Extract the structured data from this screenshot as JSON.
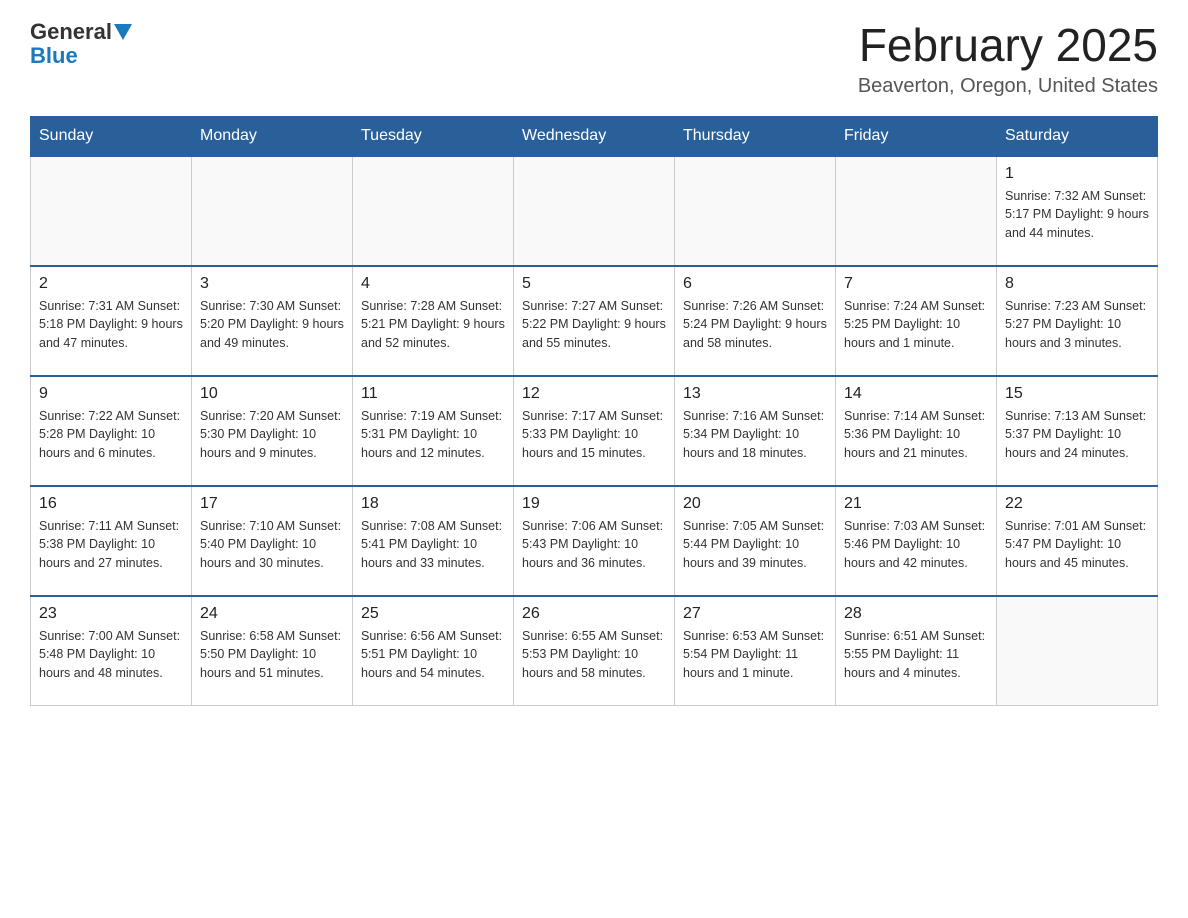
{
  "header": {
    "logo_general": "General",
    "logo_blue": "Blue",
    "main_title": "February 2025",
    "subtitle": "Beaverton, Oregon, United States"
  },
  "weekdays": [
    "Sunday",
    "Monday",
    "Tuesday",
    "Wednesday",
    "Thursday",
    "Friday",
    "Saturday"
  ],
  "weeks": [
    [
      {
        "day": "",
        "info": ""
      },
      {
        "day": "",
        "info": ""
      },
      {
        "day": "",
        "info": ""
      },
      {
        "day": "",
        "info": ""
      },
      {
        "day": "",
        "info": ""
      },
      {
        "day": "",
        "info": ""
      },
      {
        "day": "1",
        "info": "Sunrise: 7:32 AM\nSunset: 5:17 PM\nDaylight: 9 hours and 44 minutes."
      }
    ],
    [
      {
        "day": "2",
        "info": "Sunrise: 7:31 AM\nSunset: 5:18 PM\nDaylight: 9 hours and 47 minutes."
      },
      {
        "day": "3",
        "info": "Sunrise: 7:30 AM\nSunset: 5:20 PM\nDaylight: 9 hours and 49 minutes."
      },
      {
        "day": "4",
        "info": "Sunrise: 7:28 AM\nSunset: 5:21 PM\nDaylight: 9 hours and 52 minutes."
      },
      {
        "day": "5",
        "info": "Sunrise: 7:27 AM\nSunset: 5:22 PM\nDaylight: 9 hours and 55 minutes."
      },
      {
        "day": "6",
        "info": "Sunrise: 7:26 AM\nSunset: 5:24 PM\nDaylight: 9 hours and 58 minutes."
      },
      {
        "day": "7",
        "info": "Sunrise: 7:24 AM\nSunset: 5:25 PM\nDaylight: 10 hours and 1 minute."
      },
      {
        "day": "8",
        "info": "Sunrise: 7:23 AM\nSunset: 5:27 PM\nDaylight: 10 hours and 3 minutes."
      }
    ],
    [
      {
        "day": "9",
        "info": "Sunrise: 7:22 AM\nSunset: 5:28 PM\nDaylight: 10 hours and 6 minutes."
      },
      {
        "day": "10",
        "info": "Sunrise: 7:20 AM\nSunset: 5:30 PM\nDaylight: 10 hours and 9 minutes."
      },
      {
        "day": "11",
        "info": "Sunrise: 7:19 AM\nSunset: 5:31 PM\nDaylight: 10 hours and 12 minutes."
      },
      {
        "day": "12",
        "info": "Sunrise: 7:17 AM\nSunset: 5:33 PM\nDaylight: 10 hours and 15 minutes."
      },
      {
        "day": "13",
        "info": "Sunrise: 7:16 AM\nSunset: 5:34 PM\nDaylight: 10 hours and 18 minutes."
      },
      {
        "day": "14",
        "info": "Sunrise: 7:14 AM\nSunset: 5:36 PM\nDaylight: 10 hours and 21 minutes."
      },
      {
        "day": "15",
        "info": "Sunrise: 7:13 AM\nSunset: 5:37 PM\nDaylight: 10 hours and 24 minutes."
      }
    ],
    [
      {
        "day": "16",
        "info": "Sunrise: 7:11 AM\nSunset: 5:38 PM\nDaylight: 10 hours and 27 minutes."
      },
      {
        "day": "17",
        "info": "Sunrise: 7:10 AM\nSunset: 5:40 PM\nDaylight: 10 hours and 30 minutes."
      },
      {
        "day": "18",
        "info": "Sunrise: 7:08 AM\nSunset: 5:41 PM\nDaylight: 10 hours and 33 minutes."
      },
      {
        "day": "19",
        "info": "Sunrise: 7:06 AM\nSunset: 5:43 PM\nDaylight: 10 hours and 36 minutes."
      },
      {
        "day": "20",
        "info": "Sunrise: 7:05 AM\nSunset: 5:44 PM\nDaylight: 10 hours and 39 minutes."
      },
      {
        "day": "21",
        "info": "Sunrise: 7:03 AM\nSunset: 5:46 PM\nDaylight: 10 hours and 42 minutes."
      },
      {
        "day": "22",
        "info": "Sunrise: 7:01 AM\nSunset: 5:47 PM\nDaylight: 10 hours and 45 minutes."
      }
    ],
    [
      {
        "day": "23",
        "info": "Sunrise: 7:00 AM\nSunset: 5:48 PM\nDaylight: 10 hours and 48 minutes."
      },
      {
        "day": "24",
        "info": "Sunrise: 6:58 AM\nSunset: 5:50 PM\nDaylight: 10 hours and 51 minutes."
      },
      {
        "day": "25",
        "info": "Sunrise: 6:56 AM\nSunset: 5:51 PM\nDaylight: 10 hours and 54 minutes."
      },
      {
        "day": "26",
        "info": "Sunrise: 6:55 AM\nSunset: 5:53 PM\nDaylight: 10 hours and 58 minutes."
      },
      {
        "day": "27",
        "info": "Sunrise: 6:53 AM\nSunset: 5:54 PM\nDaylight: 11 hours and 1 minute."
      },
      {
        "day": "28",
        "info": "Sunrise: 6:51 AM\nSunset: 5:55 PM\nDaylight: 11 hours and 4 minutes."
      },
      {
        "day": "",
        "info": ""
      }
    ]
  ]
}
